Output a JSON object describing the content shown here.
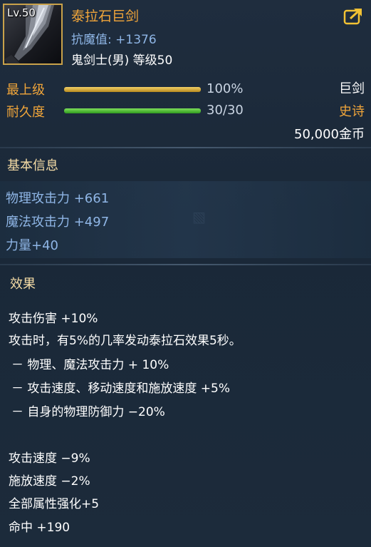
{
  "item": {
    "level_badge": "Lv.50",
    "name": "泰拉石巨剑",
    "anti_magic": "抗魔值: +1376",
    "requirement": "鬼剑士(男) 等级50",
    "icon": "greatsword-icon",
    "share_icon": "share-arrow-icon"
  },
  "stats": {
    "grade_label": "最上级",
    "grade_value": "100%",
    "grade_fill": 1.0,
    "durability_label": "耐久度",
    "durability_value": "30/30",
    "durability_fill": 1.0,
    "weapon_type": "巨剑",
    "rarity": "史诗",
    "price": "50,000金币"
  },
  "basic": {
    "title": "基本信息",
    "lines": [
      "物理攻击力 +661",
      "魔法攻击力 +497",
      "力量+40"
    ]
  },
  "effects": {
    "title": "效果",
    "lines": [
      "攻击伤害 +10%",
      "攻击时，有5%的几率发动泰拉石效果5秒。",
      "－ 物理、魔法攻击力 + 10%",
      "－ 攻击速度、移动速度和施放速度 +5%",
      "－ 自身的物理防御力 −20%",
      "攻击速度 −9%",
      "施放速度 −2%",
      "全部属性强化+5",
      "命中 +190"
    ]
  },
  "colors": {
    "title_orange": "#f0a53a",
    "blue_text": "#8fb6e6",
    "gold_bar": "#e0b84a",
    "green_bar": "#4cc636"
  }
}
